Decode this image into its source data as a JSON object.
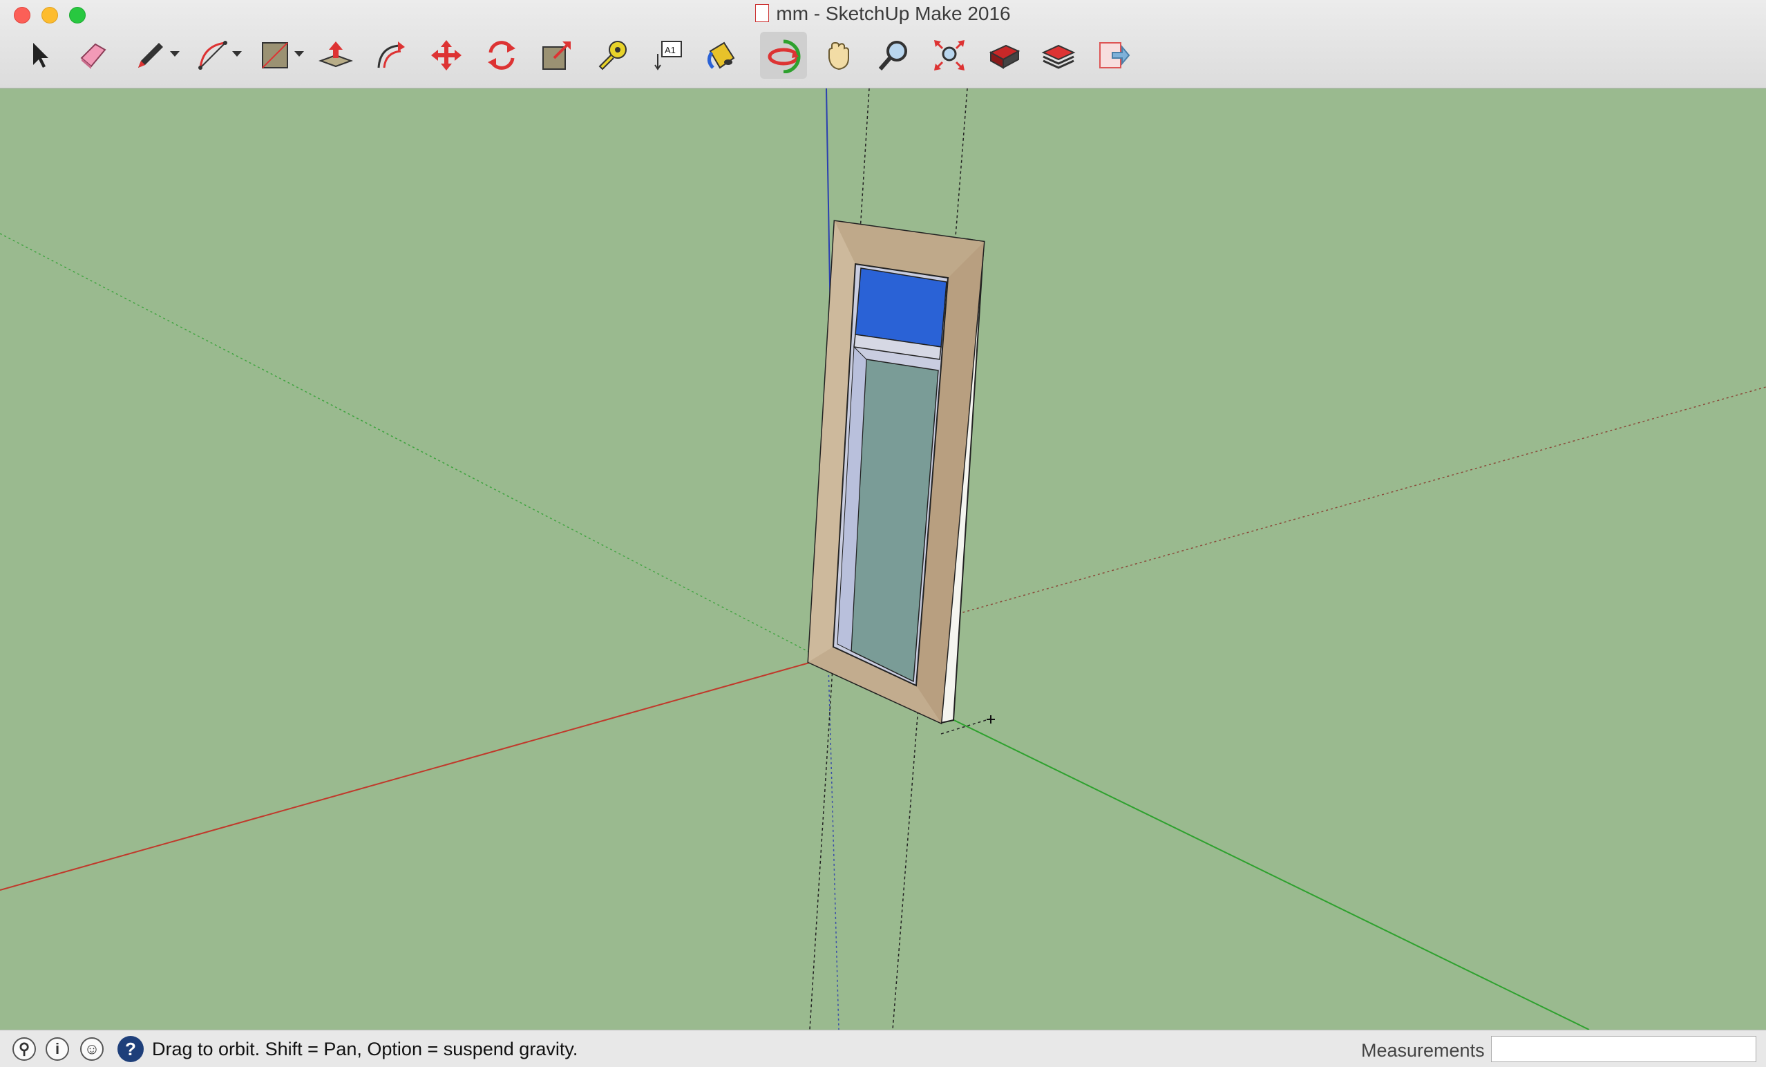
{
  "window": {
    "title": "mm - SketchUp Make 2016"
  },
  "toolbar": {
    "tools": [
      {
        "name": "select-tool",
        "icon": "arrow-icon"
      },
      {
        "name": "eraser-tool",
        "icon": "eraser-icon"
      },
      {
        "name": "line-tool",
        "icon": "pencil-icon",
        "has_menu": true
      },
      {
        "name": "arc-tool",
        "icon": "arc-icon",
        "has_menu": true
      },
      {
        "name": "rectangle-tool",
        "icon": "rectangle-icon",
        "has_menu": true
      },
      {
        "name": "push-pull-tool",
        "icon": "push-pull-icon"
      },
      {
        "name": "offset-tool",
        "icon": "offset-icon"
      },
      {
        "name": "move-tool",
        "icon": "move-icon"
      },
      {
        "name": "rotate-tool",
        "icon": "rotate-icon"
      },
      {
        "name": "scale-tool",
        "icon": "scale-icon"
      },
      {
        "name": "tape-measure-tool",
        "icon": "tape-measure-icon"
      },
      {
        "name": "text-tool",
        "icon": "text-icon",
        "label": "A1"
      },
      {
        "name": "paint-bucket-tool",
        "icon": "paint-bucket-icon"
      },
      {
        "name": "orbit-tool",
        "icon": "orbit-icon",
        "active": true
      },
      {
        "name": "pan-tool",
        "icon": "hand-icon"
      },
      {
        "name": "zoom-tool",
        "icon": "magnifier-icon"
      },
      {
        "name": "zoom-extents-tool",
        "icon": "zoom-extents-icon"
      },
      {
        "name": "3d-warehouse-tool",
        "icon": "warehouse-icon"
      },
      {
        "name": "extension-warehouse-tool",
        "icon": "extension-warehouse-icon"
      },
      {
        "name": "send-to-layout-tool",
        "icon": "layout-icon"
      }
    ]
  },
  "colors": {
    "ground": "#9aba8f",
    "red_axis": "#c0392b",
    "green_axis": "#2ea12e",
    "blue_axis": "#2a3fb0",
    "frame_wood": "#c8b497",
    "glass_top": "#2a62d6",
    "glass_bottom": "#7a9c97"
  },
  "status": {
    "message": "Drag to orbit. Shift = Pan, Option = suspend gravity.",
    "geo_icon": "location-pin-icon",
    "info_icon": "info-icon",
    "user_icon": "user-icon",
    "help_icon": "?"
  },
  "measurements": {
    "label": "Measurements",
    "value": ""
  }
}
